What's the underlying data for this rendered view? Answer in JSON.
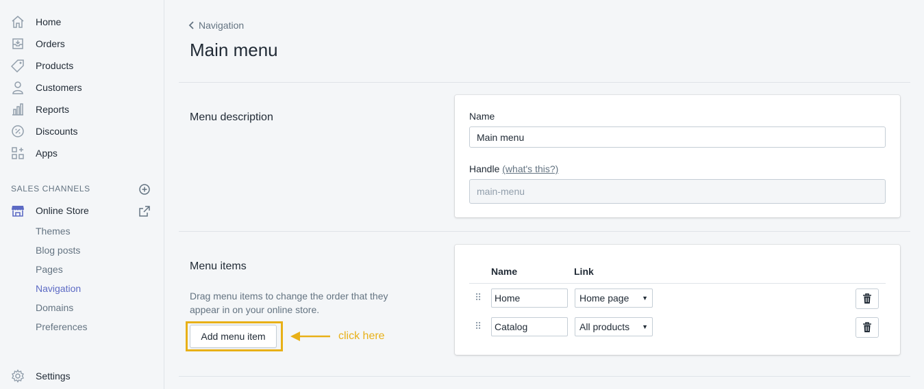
{
  "sidebar": {
    "items": [
      {
        "label": "Home",
        "icon": "home-icon"
      },
      {
        "label": "Orders",
        "icon": "orders-icon"
      },
      {
        "label": "Products",
        "icon": "tag-icon"
      },
      {
        "label": "Customers",
        "icon": "person-icon"
      },
      {
        "label": "Reports",
        "icon": "bar-chart-icon"
      },
      {
        "label": "Discounts",
        "icon": "discount-badge-icon"
      },
      {
        "label": "Apps",
        "icon": "apps-grid-icon"
      }
    ],
    "sales_channels_title": "SALES CHANNELS",
    "online_store": {
      "label": "Online Store",
      "sub_items": [
        {
          "label": "Themes"
        },
        {
          "label": "Blog posts"
        },
        {
          "label": "Pages"
        },
        {
          "label": "Navigation",
          "active": true
        },
        {
          "label": "Domains"
        },
        {
          "label": "Preferences"
        }
      ]
    },
    "settings_label": "Settings"
  },
  "header": {
    "breadcrumb": "Navigation",
    "title": "Main menu"
  },
  "menu_description": {
    "heading": "Menu description",
    "name_label": "Name",
    "name_value": "Main menu",
    "handle_label": "Handle",
    "handle_help_link": "(what's this?)",
    "handle_value": "main-menu"
  },
  "menu_items": {
    "heading": "Menu items",
    "description": "Drag menu items to change the order that they appear in on your online store.",
    "col_name": "Name",
    "col_link": "Link",
    "rows": [
      {
        "name": "Home",
        "link": "Home page"
      },
      {
        "name": "Catalog",
        "link": "All products"
      }
    ],
    "add_button": "Add menu item"
  },
  "annotation": {
    "text": "click here",
    "color": "#e8b017"
  },
  "colors": {
    "accent": "#5c6ac4",
    "sidebar_bg": "#f4f6f8",
    "text": "#212b36",
    "muted": "#637381"
  }
}
